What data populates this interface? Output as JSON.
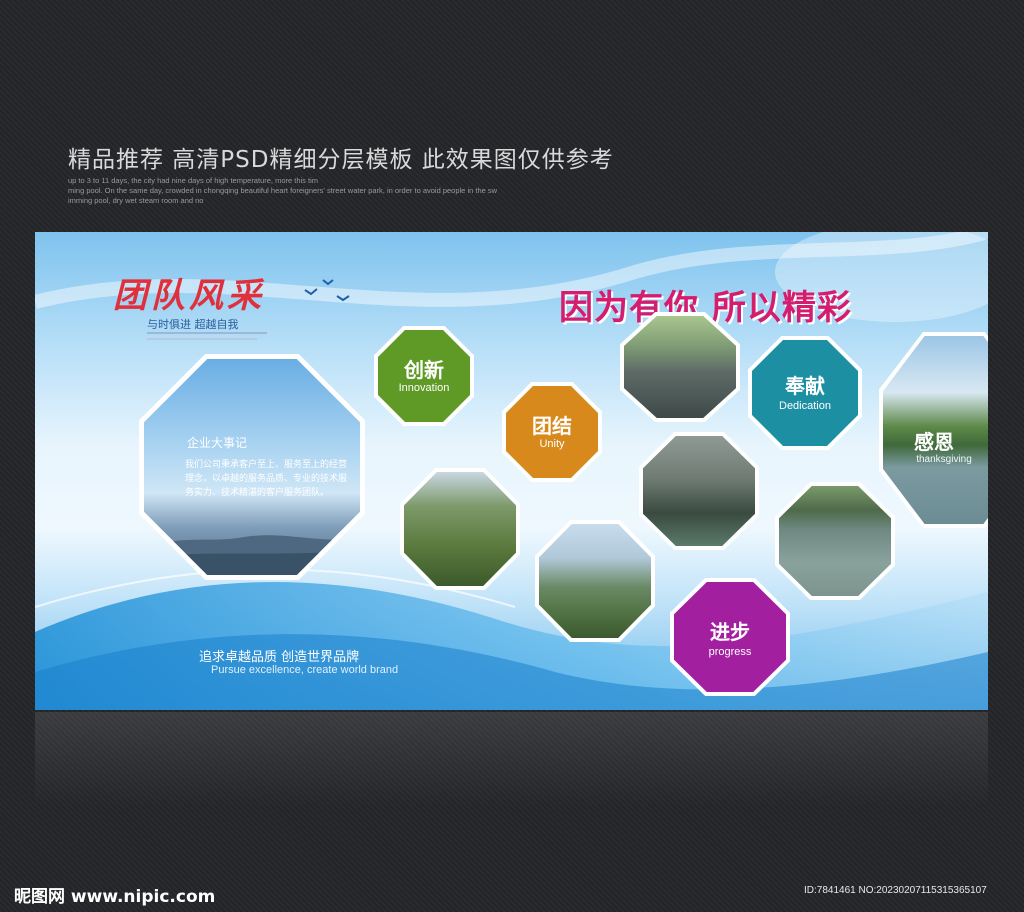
{
  "header": {
    "title": "精品推荐 高清PSD精细分层模板 此效果图仅供参考",
    "small_lines": [
      "up to 3 to 11 days, the city had nine days of high temperature, more this tim",
      "ming pool. On the same day, crowded in chongqing beautiful heart foreigners' street water park, in order to avoid people in the sw",
      "imming pool, dry wet steam room and no"
    ]
  },
  "board": {
    "logo_title": "团队风采",
    "logo_subtitle": "与时俱进 超越自我",
    "slogan": "因为有你 所以精彩",
    "intro_title": "企业大事记",
    "intro_text": "我们公司秉承客户至上、服务至上的经营理念，以卓越的服务品质、专业的技术服务实力、技术精湛的客户服务团队。",
    "tagline_cn": "追求卓越品质 创造世界品牌",
    "tagline_en": "Pursue excellence, create world brand",
    "badges": [
      {
        "cn": "创新",
        "en": "Innovation",
        "color": "#5f9a26"
      },
      {
        "cn": "团结",
        "en": "Unity",
        "color": "#d8891c"
      },
      {
        "cn": "奉献",
        "en": "Dedication",
        "color": "#1d8fa2"
      },
      {
        "cn": "进步",
        "en": "progress",
        "color": "#a21f9f"
      },
      {
        "cn": "感恩",
        "en": "thanksgiving",
        "color": ""
      }
    ]
  },
  "footer": {
    "logo": "昵图网 www.nipic.com",
    "id_text": "ID:7841461 NO:20230207115315365107"
  }
}
